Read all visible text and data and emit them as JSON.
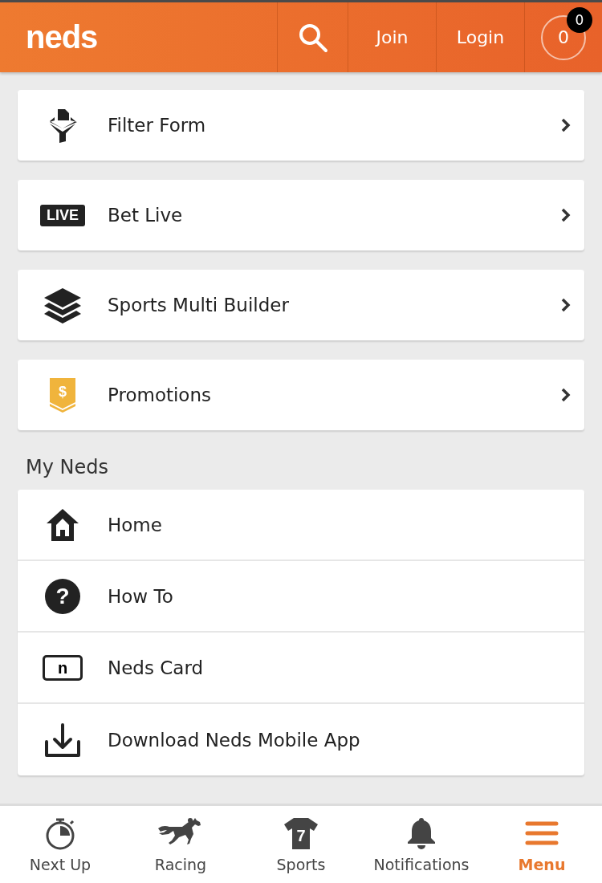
{
  "header": {
    "logo": "neds",
    "join": "Join",
    "login": "Login",
    "balance": "0",
    "badge": "0"
  },
  "quick_links": [
    {
      "kind": "filter",
      "label": "Filter Form"
    },
    {
      "kind": "live",
      "label": "Bet Live",
      "icon_text": "LIVE"
    },
    {
      "kind": "layers",
      "label": "Sports Multi Builder"
    },
    {
      "kind": "promo",
      "label": "Promotions",
      "icon_text": "$"
    }
  ],
  "my_neds": {
    "title": "My Neds",
    "items": [
      {
        "kind": "home",
        "label": "Home"
      },
      {
        "kind": "help",
        "label": "How To",
        "icon_text": "?"
      },
      {
        "kind": "card",
        "label": "Neds Card",
        "icon_text": "n"
      },
      {
        "kind": "download",
        "label": "Download Neds Mobile App"
      }
    ]
  },
  "bottom_nav": [
    {
      "kind": "timer",
      "label": "Next Up",
      "selected": false
    },
    {
      "kind": "horse",
      "label": "Racing",
      "selected": false
    },
    {
      "kind": "jersey",
      "label": "Sports",
      "selected": false,
      "icon_text": "7"
    },
    {
      "kind": "bell",
      "label": "Notifications",
      "selected": false
    },
    {
      "kind": "menu",
      "label": "Menu",
      "selected": true
    }
  ]
}
